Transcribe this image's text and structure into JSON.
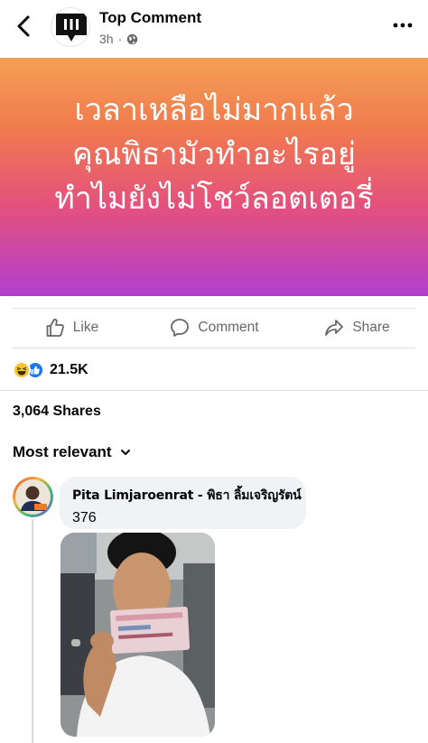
{
  "header": {
    "page_name": "Top Comment",
    "time": "3h",
    "back_icon": "chevron-left-icon",
    "privacy_icon": "globe-icon",
    "more_icon": "more-dots-icon"
  },
  "post": {
    "text_lines": [
      "เวลาเหลือไม่มากแล้ว",
      "คุณพิธามัวทำอะไรอยู่",
      "ทำไมยังไม่โชว์ลอตเตอรี่"
    ],
    "background_colors": [
      "#f4a054",
      "#f07a4e",
      "#e4517d",
      "#b23fcf"
    ]
  },
  "actions": {
    "like": "Like",
    "comment": "Comment",
    "share": "Share"
  },
  "reactions": {
    "count": "21.5K",
    "types": [
      "haha",
      "like"
    ]
  },
  "shares_label": "3,064 Shares",
  "sort_label": "Most relevant",
  "comment": {
    "author": "Pita Limjaroenrat - พิธา ลิ้มเจริญรัตน์",
    "text": "376"
  },
  "colors": {
    "accent": "#1877f2",
    "muted_text": "#65676b",
    "bubble_bg": "#f0f2f5"
  }
}
